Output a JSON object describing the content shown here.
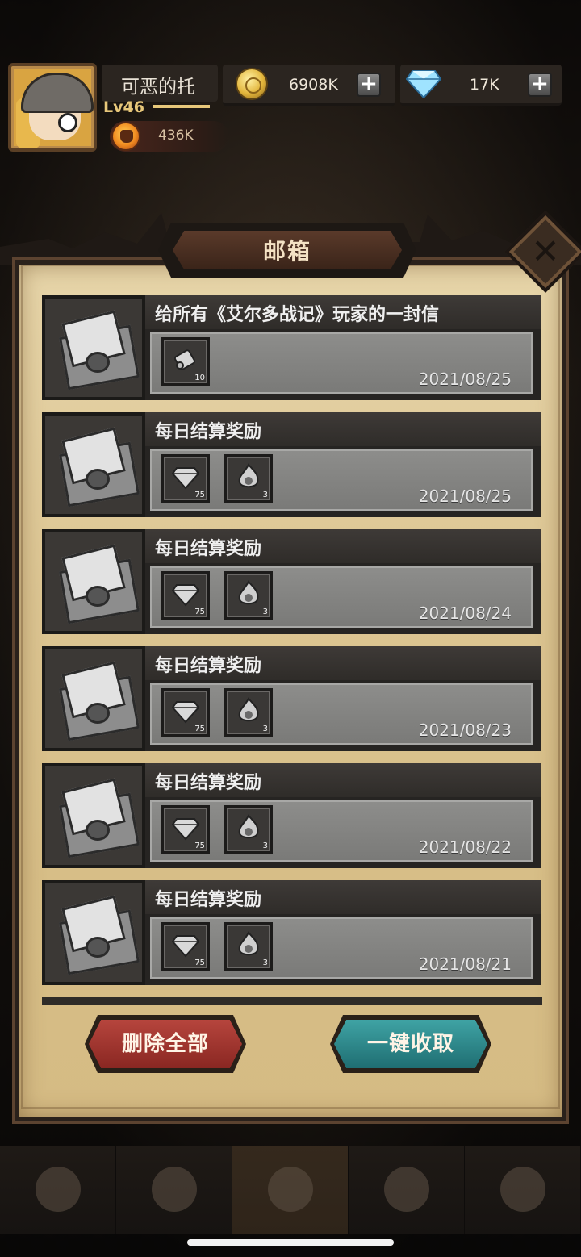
{
  "player": {
    "name": "可恶的托",
    "level": "Lv46",
    "power": "436K"
  },
  "resources": {
    "gold": "6908K",
    "gems": "17K"
  },
  "mailbox": {
    "title": "邮箱",
    "mails": [
      {
        "title": "给所有《艾尔多战记》玩家的一封信",
        "date": "2021/08/25",
        "rewards": [
          {
            "icon": "scroll-icon",
            "qty": "10"
          }
        ]
      },
      {
        "title": "每日结算奖励",
        "date": "2021/08/25",
        "rewards": [
          {
            "icon": "diamond-icon",
            "qty": "75"
          },
          {
            "icon": "flame-token-icon",
            "qty": "3"
          }
        ]
      },
      {
        "title": "每日结算奖励",
        "date": "2021/08/24",
        "rewards": [
          {
            "icon": "diamond-icon",
            "qty": "75"
          },
          {
            "icon": "flame-token-icon",
            "qty": "3"
          }
        ]
      },
      {
        "title": "每日结算奖励",
        "date": "2021/08/23",
        "rewards": [
          {
            "icon": "diamond-icon",
            "qty": "75"
          },
          {
            "icon": "flame-token-icon",
            "qty": "3"
          }
        ]
      },
      {
        "title": "每日结算奖励",
        "date": "2021/08/22",
        "rewards": [
          {
            "icon": "diamond-icon",
            "qty": "75"
          },
          {
            "icon": "flame-token-icon",
            "qty": "3"
          }
        ]
      },
      {
        "title": "每日结算奖励",
        "date": "2021/08/21",
        "rewards": [
          {
            "icon": "diamond-icon",
            "qty": "75"
          },
          {
            "icon": "flame-token-icon",
            "qty": "3"
          }
        ]
      }
    ],
    "delete_all_label": "删除全部",
    "claim_all_label": "一键收取"
  },
  "colors": {
    "parchment": "#dcc592",
    "delete_button": "#b6453d",
    "claim_button": "#3fa3a4",
    "mail_read_gray": "#8d8d8b"
  }
}
